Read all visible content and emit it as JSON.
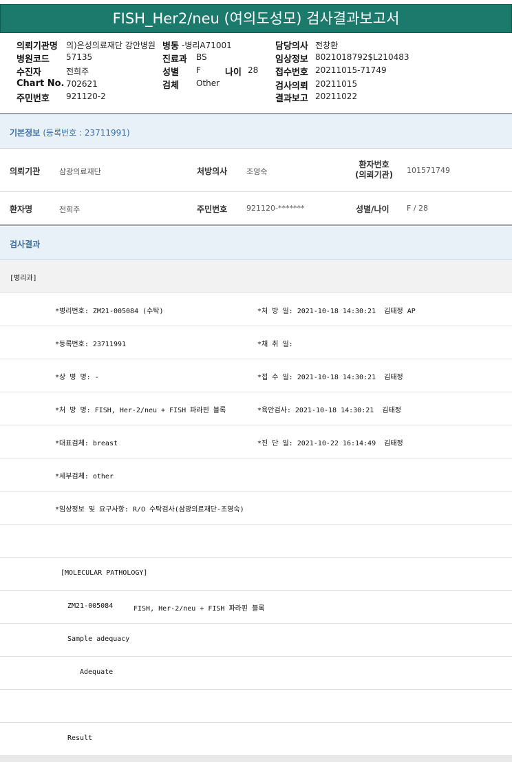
{
  "title": "FISH_Her2/neu (여의도성모) 검사결과보고서",
  "header": {
    "institution_label": "의뢰기관명",
    "institution_value": "의)은성의료재단 강안병원",
    "ward_label": "병동",
    "ward_value": "-병리A71001",
    "doctor_label": "담당의사",
    "doctor_value": "전창환",
    "hospital_code_label": "병원코드",
    "hospital_code_value": "57135",
    "dept_label": "진료과",
    "dept_value": "BS",
    "clinical_label": "임상정보",
    "clinical_value": "8021018792$L210483",
    "patient_label": "수진자",
    "patient_value": "전희주",
    "sex_label": "성별",
    "sex_value": "F",
    "age_label": "나이",
    "age_value": "28",
    "receipt_no_label": "접수번호",
    "receipt_no_value": "20211015-71749",
    "chart_label": "Chart No.",
    "chart_value": "702621",
    "specimen_label": "검체",
    "specimen_value": "Other",
    "req_date_label": "검사의뢰",
    "req_date_value": "20211015",
    "id_label": "주민번호",
    "id_value": "921120-2",
    "report_label": "결과보고",
    "report_value": "20211022"
  },
  "basic_info": {
    "heading": "기본정보",
    "reg_text": "(등록번호 : 23711991)",
    "row1": {
      "k1": "의뢰기관",
      "v1": "삼광의료재단",
      "k2": "처방의사",
      "v2": "조영숙",
      "k3_line1": "환자번호",
      "k3_line2": "(의뢰기관)",
      "v3": "101571749"
    },
    "row2": {
      "k1": "환자명",
      "v1": "전희주",
      "k2": "주민번호",
      "v2": "921120-*******",
      "k3": "성별/나이",
      "v3": "F / 28"
    }
  },
  "result": {
    "heading": "검사결과",
    "dept_line": "[병리과]",
    "fields": [
      {
        "left": "*병리번호: ZM21-005084 (수탁)",
        "right": "*처 방 일: 2021-10-18 14:30:21  김태정 AP"
      },
      {
        "left": "*등록번호: 23711991",
        "right": "*채 취 일:"
      },
      {
        "left": "*상 병 명: -",
        "right": "*접 수 일: 2021-10-18 14:30:21  김태정"
      },
      {
        "left": "*처 방 명: FISH, Her-2/neu + FISH 파라핀 블록",
        "right": "*육안검사: 2021-10-18 14:30:21  김태정"
      },
      {
        "left": "*대표검체: breast",
        "right": "*진 단 일: 2021-10-22 16:14:49  김태정"
      },
      {
        "left": "*세부검체: other",
        "right": ""
      },
      {
        "left": "*임상정보 및 요구사항: R/O 수탁검사(삼광의료재단-조영숙)",
        "right": ""
      }
    ],
    "molecular_heading": "[MOLECULAR PATHOLOGY]",
    "case_line_id": "ZM21-005084",
    "case_line_test": "FISH, Her-2/neu + FISH 파라핀 블록",
    "sample_label": "Sample adequacy",
    "sample_value": "Adequate",
    "result_label": "Result"
  }
}
